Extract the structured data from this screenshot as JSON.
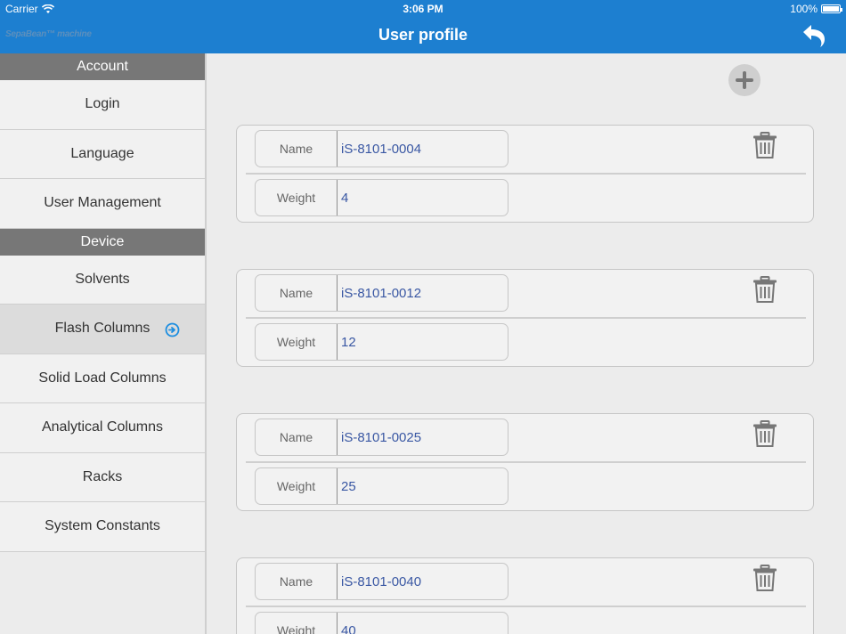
{
  "status": {
    "carrier": "Carrier",
    "time": "3:06 PM",
    "battery": "100%"
  },
  "nav": {
    "logo": "SepaBean™ machine",
    "title": "User profile"
  },
  "sidebar": {
    "account_header": "Account",
    "account_items": [
      {
        "label": "Login"
      },
      {
        "label": "Language"
      },
      {
        "label": "User Management"
      }
    ],
    "device_header": "Device",
    "device_items": [
      {
        "label": "Solvents"
      },
      {
        "label": "Flash Columns"
      },
      {
        "label": "Solid Load Columns"
      },
      {
        "label": "Analytical Columns"
      },
      {
        "label": "Racks"
      },
      {
        "label": "System Constants"
      }
    ],
    "active_item": "Flash Columns"
  },
  "main": {
    "field_labels": {
      "name": "Name",
      "weight": "Weight"
    },
    "columns": [
      {
        "name": "iS-8101-0004",
        "weight": "4"
      },
      {
        "name": "iS-8101-0012",
        "weight": "12"
      },
      {
        "name": "iS-8101-0025",
        "weight": "25"
      },
      {
        "name": "iS-8101-0040",
        "weight": "40"
      }
    ]
  },
  "colors": {
    "accent": "#1d7fd0",
    "value_text": "#3957a3",
    "section_header": "#777777"
  },
  "icons": [
    "wifi-icon",
    "battery-icon",
    "back-arrow-icon",
    "arrow-circle-right-icon",
    "plus-icon",
    "trash-icon"
  ]
}
